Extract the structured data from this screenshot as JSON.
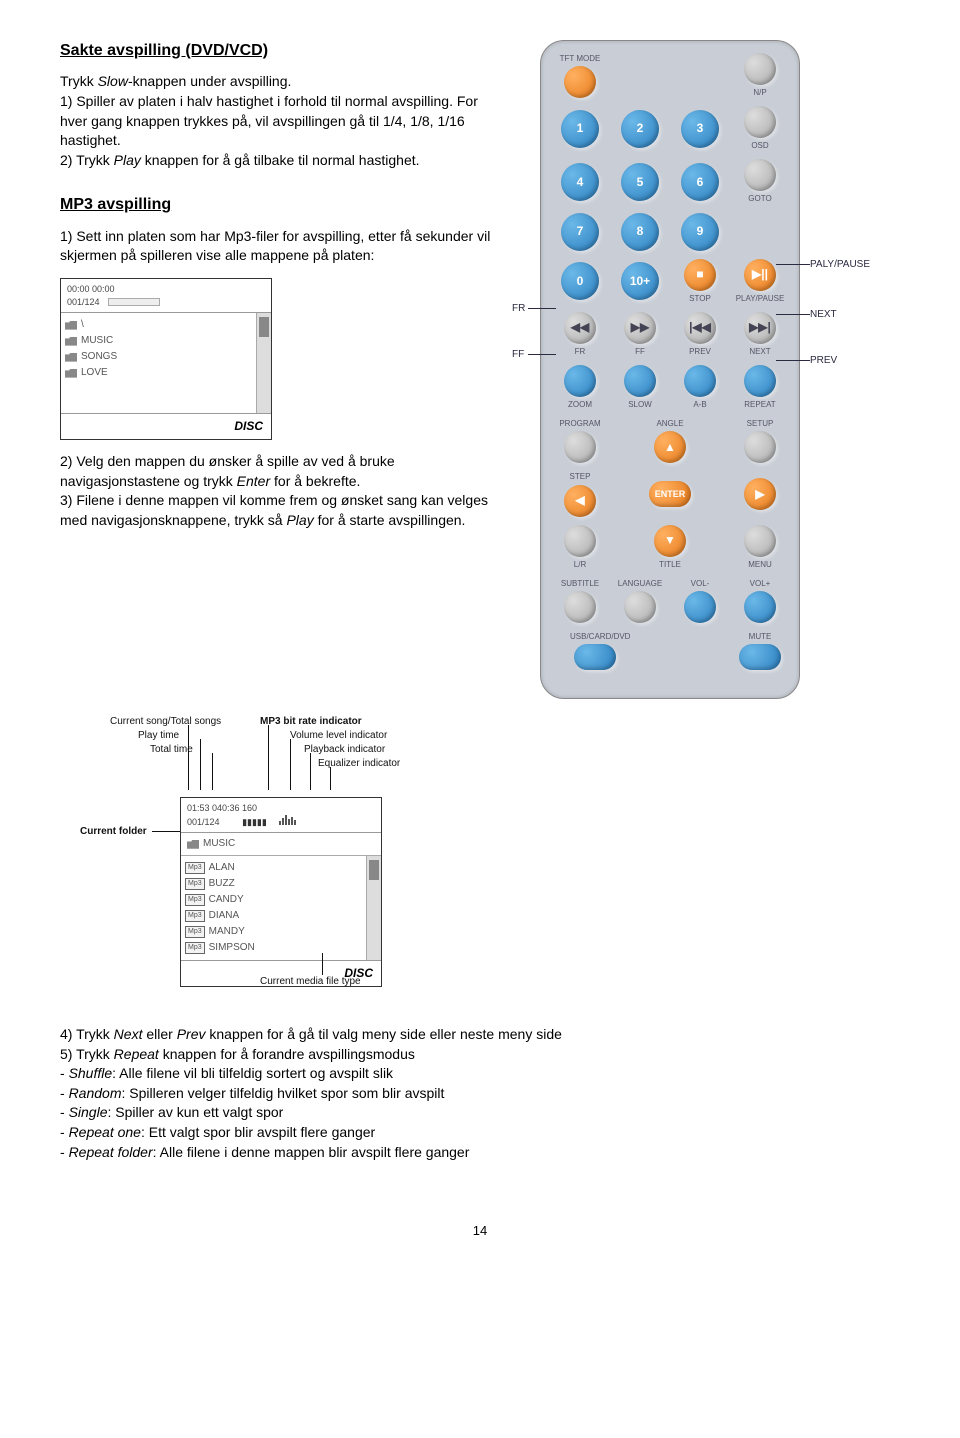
{
  "page_number": "14",
  "h1": "Sakte avspilling (DVD/VCD)",
  "p1a_pre": "Trykk ",
  "p1a_it": "Slow",
  "p1a_post": "-knappen under avspilling.",
  "p1b": "1) Spiller av platen i halv hastighet i forhold til normal avspilling. For hver gang knappen trykkes på, vil avspillingen gå til 1/4, 1/8, 1/16 hastighet.",
  "p1c_pre": "2) Trykk ",
  "p1c_it": "Play",
  "p1c_post": " knappen for å gå tilbake til normal hastighet.",
  "h2": "MP3 avspilling",
  "p2a": "1) Sett inn platen som har Mp3-filer for avspilling, etter få sekunder vil skjermen på spilleren vise alle mappene på platen:",
  "disc1": {
    "time": "00:00  00:00",
    "counter": "001/124",
    "items": [
      "\\",
      "MUSIC",
      "SONGS",
      "LOVE"
    ],
    "footer": "DISC"
  },
  "p2b_pre": "2) Velg den mappen du ønsker å spille av ved å bruke navigasjonstastene og trykk ",
  "p2b_it": "Enter",
  "p2b_post": " for å bekrefte.",
  "p2c_pre": "3) Filene i denne mappen vil komme frem og ønsket sang kan velges med navigasjonsknappene, trykk så ",
  "p2c_it": "Play",
  "p2c_post": " for å starte avspillingen.",
  "diagram": {
    "header_line1": "01:53 040:36 160",
    "header_line2": "001/124",
    "folder": "MUSIC",
    "tracks": [
      "ALAN",
      "BUZZ",
      "CANDY",
      "DIANA",
      "MANDY",
      "SIMPSON"
    ],
    "footer": "DISC",
    "ann_current_song": "Current song/Total songs",
    "ann_play_time": "Play time",
    "ann_total_time": "Total time",
    "ann_bitrate": "MP3 bit rate indicator",
    "ann_volume": "Volume level indicator",
    "ann_playback": "Playback indicator",
    "ann_eq": "Equalizer indicator",
    "ann_folder": "Current folder",
    "ann_media": "Current media file type"
  },
  "p4_pre": "4) Trykk ",
  "p4_it1": "Next",
  "p4_mid": " eller ",
  "p4_it2": "Prev",
  "p4_post": " knappen for å gå til valg meny side eller neste meny side",
  "p5_pre": "5) Trykk ",
  "p5_it": "Repeat",
  "p5_post": " knappen for å forandre avspillingsmodus",
  "li1_pre": "- ",
  "li1_it": "Shuffle",
  "li1_post": ": Alle filene vil bli tilfeldig sortert og avspilt slik",
  "li2_pre": "- ",
  "li2_it": "Random",
  "li2_post": ": Spilleren velger tilfeldig hvilket spor som blir avspilt",
  "li3_pre": "- ",
  "li3_it": "Single",
  "li3_post": ": Spiller av kun ett valgt spor",
  "li4_pre": "- ",
  "li4_it": "Repeat one",
  "li4_post": ": Ett valgt spor blir avspilt flere ganger",
  "li5_pre": "- ",
  "li5_it": "Repeat folder",
  "li5_post": ": Alle filene i denne mappen blir avspilt flere ganger",
  "remote": {
    "tft": "TFT MODE",
    "np": "N/P",
    "osd": "OSD",
    "goto": "GOTO",
    "n1": "1",
    "n2": "2",
    "n3": "3",
    "n4": "4",
    "n5": "5",
    "n6": "6",
    "n7": "7",
    "n8": "8",
    "n9": "9",
    "n0": "0",
    "n10": "10+",
    "stop": "STOP",
    "playpause": "PLAY/PAUSE",
    "fr": "FR",
    "ff": "FF",
    "prev": "PREV",
    "next": "NEXT",
    "zoom": "ZOOM",
    "slow": "SLOW",
    "ab": "A-B",
    "repeat": "REPEAT",
    "program": "PROGRAM",
    "angle": "ANGLE",
    "setup": "SETUP",
    "step": "STEP",
    "enter": "ENTER",
    "lr": "L/R",
    "title": "TITLE",
    "menu": "MENU",
    "subtitle": "SUBTITLE",
    "language": "LANGUAGE",
    "volm": "VOL-",
    "volp": "VOL+",
    "usb": "USB/CARD/DVD",
    "mute": "MUTE",
    "call_playpause": "PALY/PAUSE",
    "call_next": "NEXT",
    "call_prev": "PREV",
    "call_fr": "FR",
    "call_ff": "FF"
  }
}
